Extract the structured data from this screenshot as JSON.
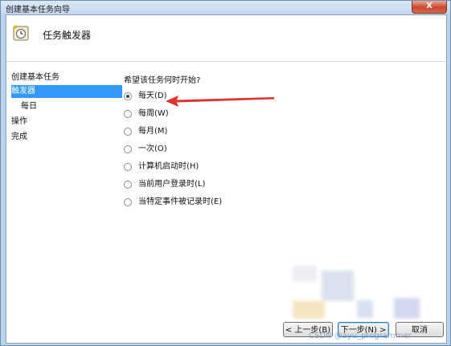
{
  "window": {
    "title": "创建基本任务向导",
    "close_label": "X"
  },
  "header": {
    "title": "任务触发器",
    "icon": "clock-task-icon"
  },
  "steps": [
    {
      "label": "创建基本任务"
    },
    {
      "label": "触发器"
    },
    {
      "label": "每日"
    },
    {
      "label": "操作"
    },
    {
      "label": "完成"
    }
  ],
  "question": "希望该任务何时开始?",
  "options": [
    {
      "label": "每天(D)",
      "checked": true
    },
    {
      "label": "每周(W)",
      "checked": false
    },
    {
      "label": "每月(M)",
      "checked": false
    },
    {
      "label": "一次(O)",
      "checked": false
    },
    {
      "label": "计算机启动时(H)",
      "checked": false
    },
    {
      "label": "当前用户登录时(L)",
      "checked": false
    },
    {
      "label": "当特定事件被记录时(E)",
      "checked": false
    }
  ],
  "buttons": {
    "back": "< 上一步(B)",
    "next": "下一步(N) >",
    "cancel": "取消"
  },
  "watermark": "CSDN @ayu_programmer",
  "colors": {
    "selection": "#3399ff",
    "arrow": "#e03030"
  }
}
